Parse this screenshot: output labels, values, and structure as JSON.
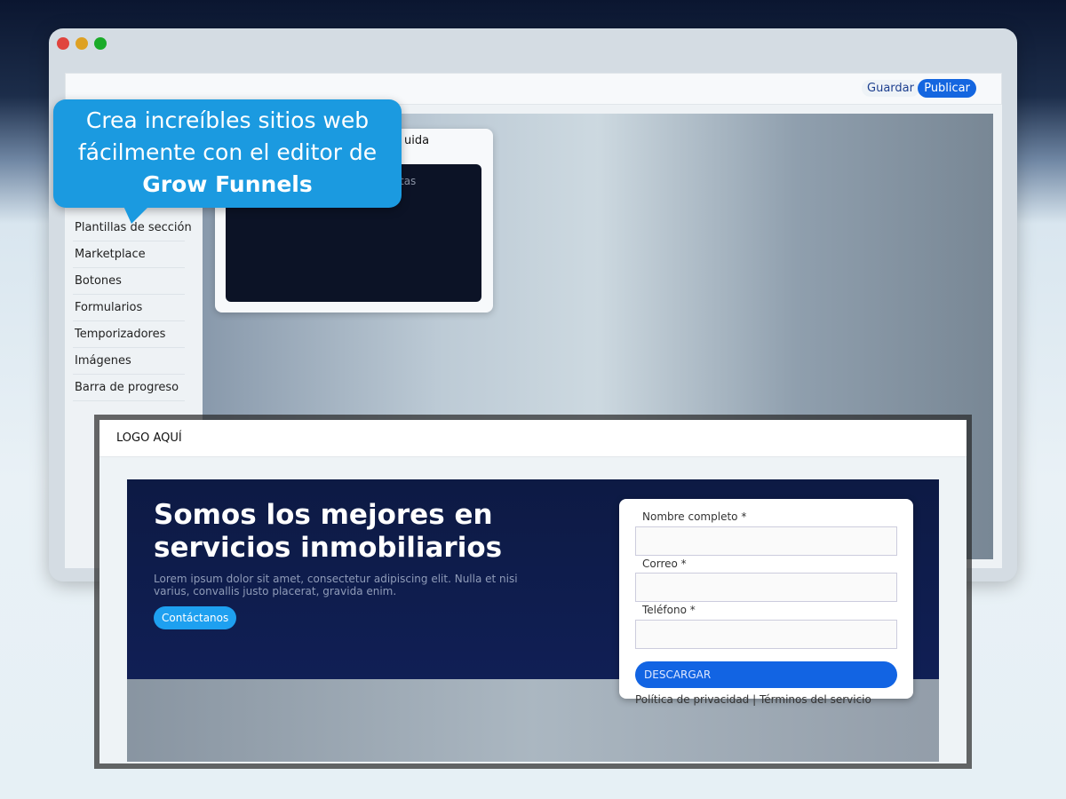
{
  "window": {
    "colors": {
      "close": "#e0443e",
      "minimize": "#dea123",
      "zoom": "#1aab29"
    }
  },
  "toolbar": {
    "save_label": "Guardar",
    "publish_label": "Publicar"
  },
  "sidebar": {
    "items": [
      {
        "label": "Plantillas de sección"
      },
      {
        "label": "Marketplace"
      },
      {
        "label": "Botones"
      },
      {
        "label": "Formularios"
      },
      {
        "label": "Temporizadores"
      },
      {
        "label": "Imágenes"
      },
      {
        "label": "Barra de progreso"
      }
    ]
  },
  "panel": {
    "title_fragment": "uida",
    "text_fragment": "tas"
  },
  "callout": {
    "line1": "Crea increíbles sitios web",
    "line2": "fácilmente con el editor de",
    "brand": "Grow Funnels",
    "color": "#1b9ae0"
  },
  "landing": {
    "logo": "LOGO AQUÍ",
    "headline": "Somos los mejores en servicios inmobiliarios",
    "body": "Lorem ipsum dolor sit amet, consectetur adipiscing elit. Nulla et nisi varius, convallis justo placerat, gravida enim.",
    "cta": "Contáctanos",
    "form": {
      "name_label": "Nombre completo *",
      "email_label": "Correo *",
      "phone_label": "Teléfono *",
      "name_value": "",
      "email_value": "",
      "phone_value": "",
      "submit": "DESCARGAR"
    },
    "links": {
      "privacy": "Política de privacidad",
      "separator": "|",
      "terms": "Términos del servicio"
    }
  }
}
